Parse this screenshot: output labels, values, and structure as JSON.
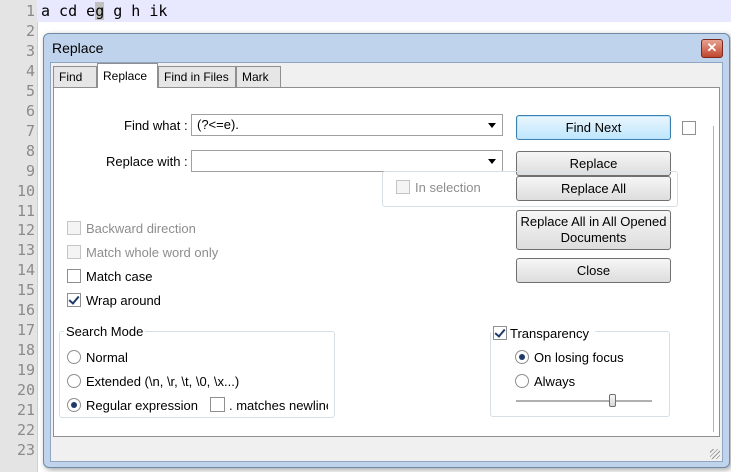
{
  "editor": {
    "line_numbers": [
      "1",
      "2",
      "3",
      "4",
      "5",
      "6",
      "7",
      "8",
      "9",
      "10",
      "11",
      "12",
      "13",
      "14",
      "15",
      "16",
      "17",
      "18",
      "19",
      "20",
      "21",
      "22",
      "23"
    ],
    "line1_before": "a cd e",
    "line1_highlight": "g",
    "line1_after": " g h ik"
  },
  "dialog": {
    "title": "Replace",
    "close_glyph": "✕",
    "tabs": [
      {
        "label": "Find",
        "active": false
      },
      {
        "label": "Replace",
        "active": true
      },
      {
        "label": "Find in Files",
        "active": false
      },
      {
        "label": "Mark",
        "active": false
      }
    ],
    "find_what_label": "Find what :",
    "find_what_value": "(?<=e).",
    "replace_with_label": "Replace with :",
    "replace_with_value": "",
    "in_selection_label": "In selection",
    "options": {
      "backward_direction": {
        "label": "Backward direction",
        "checked": false,
        "enabled": false
      },
      "match_whole_word": {
        "label": "Match whole word only",
        "checked": false,
        "enabled": false
      },
      "match_case": {
        "label": "Match case",
        "checked": false,
        "enabled": true
      },
      "wrap_around": {
        "label": "Wrap around",
        "checked": true,
        "enabled": true
      }
    },
    "search_mode": {
      "title": "Search Mode",
      "normal": "Normal",
      "extended": "Extended (\\n, \\r, \\t, \\0, \\x...)",
      "regex": "Regular expression",
      "selected": "regex",
      "matches_newline": ". matches newline"
    },
    "buttons": {
      "find_next": "Find Next",
      "replace": "Replace",
      "replace_all": "Replace All",
      "replace_all_opened_line1": "Replace All in All Opened",
      "replace_all_opened_line2": "Documents",
      "close": "Close"
    },
    "transparency": {
      "label": "Transparency",
      "checked": true,
      "on_losing_focus": "On losing focus",
      "always": "Always",
      "selected": "on_losing_focus",
      "slider_level": 0.72
    }
  }
}
